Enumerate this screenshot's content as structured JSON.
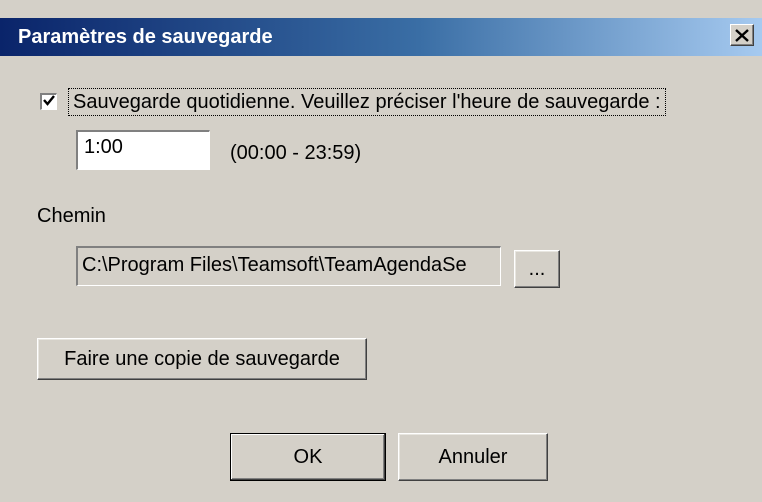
{
  "window": {
    "title": "Paramètres de sauvegarde",
    "close_label": "×"
  },
  "daily_backup": {
    "checked": true,
    "label": "Sauvegarde quotidienne. Veuillez préciser l'heure de sauvegarde :",
    "time_value": "1:00",
    "time_range": "(00:00 - 23:59)"
  },
  "path": {
    "label": "Chemin",
    "value": "C:\\Program Files\\Teamsoft\\TeamAgendaSe",
    "browse_label": "..."
  },
  "actions": {
    "backup_now_label": "Faire une copie de sauvegarde",
    "ok_label": "OK",
    "cancel_label": "Annuler"
  }
}
